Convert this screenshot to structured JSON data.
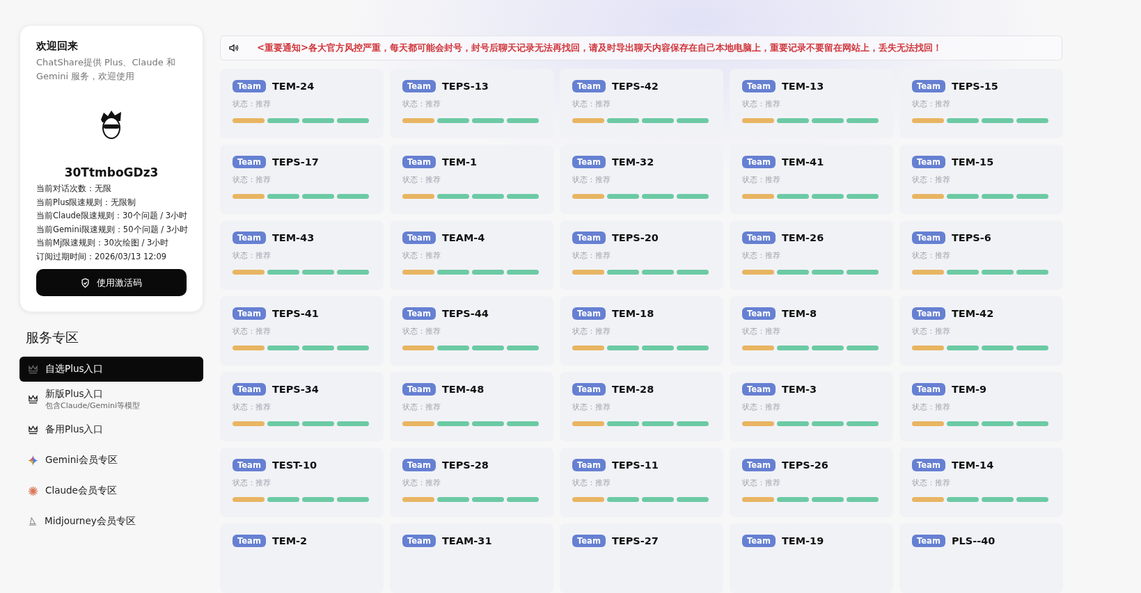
{
  "profile": {
    "title": "欢迎回来",
    "subtitle": "ChatShare提供 Plus、Claude 和 Gemini 服务，欢迎使用",
    "username": "30TtmboGDz3",
    "info": [
      "当前对话次数：无限",
      "当前Plus限速规则：无限制",
      "当前Claude限速规则：30个问题 / 3小时",
      "当前Gemini限速规则：50个问题 / 3小时",
      "当前Mj限速规则：30次绘图 / 3小时",
      "订阅过期时间：2026/03/13 12:09"
    ],
    "button": "使用激活码"
  },
  "sidebar": {
    "heading": "服务专区",
    "items": [
      {
        "kind": "crown",
        "label": "自选Plus入口",
        "selected": true
      },
      {
        "kind": "crown",
        "label": "新版Plus入口",
        "sub": "包含Claude/Gemini等模型",
        "selected": false
      },
      {
        "kind": "crown",
        "label": "备用Plus入口",
        "selected": false
      },
      {
        "kind": "gemini",
        "label": "Gemini会员专区",
        "selected": false
      },
      {
        "kind": "claude",
        "label": "Claude会员专区",
        "selected": false
      },
      {
        "kind": "midjourney",
        "label": "Midjourney会员专区",
        "selected": false
      }
    ]
  },
  "notice": "<重要通知>各大官方风控严重，每天都可能会封号，封号后聊天记录无法再找回，请及时导出聊天内容保存在自己本地电脑上，重要记录不要留在网站上，丢失无法找回！",
  "cards": [
    {
      "badge": "Team",
      "name": "TEM-24",
      "status": "状态：推荐",
      "bars": [
        {
          "color": "#e8b562"
        },
        {
          "color": "#6ccaa4"
        },
        {
          "color": "#6ccaa4"
        },
        {
          "color": "#6ccaa4"
        }
      ]
    },
    {
      "badge": "Team",
      "name": "TEPS-13",
      "status": "状态：推荐",
      "bars": [
        {
          "color": "#e8b562"
        },
        {
          "color": "#6ccaa4"
        },
        {
          "color": "#6ccaa4"
        },
        {
          "color": "#6ccaa4"
        }
      ]
    },
    {
      "badge": "Team",
      "name": "TEPS-42",
      "status": "状态：推荐",
      "bars": [
        {
          "color": "#e8b562"
        },
        {
          "color": "#6ccaa4"
        },
        {
          "color": "#6ccaa4"
        },
        {
          "color": "#6ccaa4"
        }
      ]
    },
    {
      "badge": "Team",
      "name": "TEM-13",
      "status": "状态：推荐",
      "bars": [
        {
          "color": "#e8b562"
        },
        {
          "color": "#6ccaa4"
        },
        {
          "color": "#6ccaa4"
        },
        {
          "color": "#6ccaa4"
        }
      ]
    },
    {
      "badge": "Team",
      "name": "TEPS-15",
      "status": "状态：推荐",
      "bars": [
        {
          "color": "#e8b562"
        },
        {
          "color": "#6ccaa4"
        },
        {
          "color": "#6ccaa4"
        },
        {
          "color": "#6ccaa4"
        }
      ]
    },
    {
      "badge": "Team",
      "name": "TEPS-17",
      "status": "状态：推荐",
      "bars": [
        {
          "color": "#e8b562"
        },
        {
          "color": "#6ccaa4"
        },
        {
          "color": "#6ccaa4"
        },
        {
          "color": "#6ccaa4"
        }
      ]
    },
    {
      "badge": "Team",
      "name": "TEM-1",
      "status": "状态：推荐",
      "bars": [
        {
          "color": "#e8b562"
        },
        {
          "color": "#6ccaa4"
        },
        {
          "color": "#6ccaa4"
        },
        {
          "color": "#6ccaa4"
        }
      ]
    },
    {
      "badge": "Team",
      "name": "TEM-32",
      "status": "状态：推荐",
      "bars": [
        {
          "color": "#e8b562"
        },
        {
          "color": "#6ccaa4"
        },
        {
          "color": "#6ccaa4"
        },
        {
          "color": "#6ccaa4"
        }
      ]
    },
    {
      "badge": "Team",
      "name": "TEM-41",
      "status": "状态：推荐",
      "bars": [
        {
          "color": "#e8b562"
        },
        {
          "color": "#6ccaa4"
        },
        {
          "color": "#6ccaa4"
        },
        {
          "color": "#6ccaa4"
        }
      ]
    },
    {
      "badge": "Team",
      "name": "TEM-15",
      "status": "状态：推荐",
      "bars": [
        {
          "color": "#e8b562"
        },
        {
          "color": "#6ccaa4"
        },
        {
          "color": "#6ccaa4"
        },
        {
          "color": "#6ccaa4"
        }
      ]
    },
    {
      "badge": "Team",
      "name": "TEM-43",
      "status": "状态：推荐",
      "bars": [
        {
          "color": "#e8b562"
        },
        {
          "color": "#6ccaa4"
        },
        {
          "color": "#6ccaa4"
        },
        {
          "color": "#6ccaa4"
        }
      ]
    },
    {
      "badge": "Team",
      "name": "TEAM-4",
      "status": "状态：推荐",
      "bars": [
        {
          "color": "#e8b562"
        },
        {
          "color": "#6ccaa4"
        },
        {
          "color": "#6ccaa4"
        },
        {
          "color": "#6ccaa4"
        }
      ]
    },
    {
      "badge": "Team",
      "name": "TEPS-20",
      "status": "状态：推荐",
      "bars": [
        {
          "color": "#e8b562"
        },
        {
          "color": "#6ccaa4"
        },
        {
          "color": "#6ccaa4"
        },
        {
          "color": "#6ccaa4"
        }
      ]
    },
    {
      "badge": "Team",
      "name": "TEM-26",
      "status": "状态：推荐",
      "bars": [
        {
          "color": "#e8b562"
        },
        {
          "color": "#6ccaa4"
        },
        {
          "color": "#6ccaa4"
        },
        {
          "color": "#6ccaa4"
        }
      ]
    },
    {
      "badge": "Team",
      "name": "TEPS-6",
      "status": "状态：推荐",
      "bars": [
        {
          "color": "#e8b562"
        },
        {
          "color": "#6ccaa4"
        },
        {
          "color": "#6ccaa4"
        },
        {
          "color": "#6ccaa4"
        }
      ]
    },
    {
      "badge": "Team",
      "name": "TEPS-41",
      "status": "状态：推荐",
      "bars": [
        {
          "color": "#e8b562"
        },
        {
          "color": "#6ccaa4"
        },
        {
          "color": "#6ccaa4"
        },
        {
          "color": "#6ccaa4"
        }
      ]
    },
    {
      "badge": "Team",
      "name": "TEPS-44",
      "status": "状态：推荐",
      "bars": [
        {
          "color": "#e8b562"
        },
        {
          "color": "#6ccaa4"
        },
        {
          "color": "#6ccaa4"
        },
        {
          "color": "#6ccaa4"
        }
      ]
    },
    {
      "badge": "Team",
      "name": "TEM-18",
      "status": "状态：推荐",
      "bars": [
        {
          "color": "#e8b562"
        },
        {
          "color": "#6ccaa4"
        },
        {
          "color": "#6ccaa4"
        },
        {
          "color": "#6ccaa4"
        }
      ]
    },
    {
      "badge": "Team",
      "name": "TEM-8",
      "status": "状态：推荐",
      "bars": [
        {
          "color": "#e8b562"
        },
        {
          "color": "#6ccaa4"
        },
        {
          "color": "#6ccaa4"
        },
        {
          "color": "#6ccaa4"
        }
      ]
    },
    {
      "badge": "Team",
      "name": "TEM-42",
      "status": "状态：推荐",
      "bars": [
        {
          "color": "#e8b562"
        },
        {
          "color": "#6ccaa4"
        },
        {
          "color": "#6ccaa4"
        },
        {
          "color": "#6ccaa4"
        }
      ]
    },
    {
      "badge": "Team",
      "name": "TEPS-34",
      "status": "状态：推荐",
      "bars": [
        {
          "color": "#e8b562"
        },
        {
          "color": "#6ccaa4"
        },
        {
          "color": "#6ccaa4"
        },
        {
          "color": "#6ccaa4"
        }
      ]
    },
    {
      "badge": "Team",
      "name": "TEM-48",
      "status": "状态：推荐",
      "bars": [
        {
          "color": "#e8b562"
        },
        {
          "color": "#6ccaa4"
        },
        {
          "color": "#6ccaa4"
        },
        {
          "color": "#6ccaa4"
        }
      ]
    },
    {
      "badge": "Team",
      "name": "TEM-28",
      "status": "状态：推荐",
      "bars": [
        {
          "color": "#e8b562"
        },
        {
          "color": "#6ccaa4"
        },
        {
          "color": "#6ccaa4"
        },
        {
          "color": "#6ccaa4"
        }
      ]
    },
    {
      "badge": "Team",
      "name": "TEM-3",
      "status": "状态：推荐",
      "bars": [
        {
          "color": "#e8b562"
        },
        {
          "color": "#6ccaa4"
        },
        {
          "color": "#6ccaa4"
        },
        {
          "color": "#6ccaa4"
        }
      ]
    },
    {
      "badge": "Team",
      "name": "TEM-9",
      "status": "状态：推荐",
      "bars": [
        {
          "color": "#e8b562"
        },
        {
          "color": "#6ccaa4"
        },
        {
          "color": "#6ccaa4"
        },
        {
          "color": "#6ccaa4"
        }
      ]
    },
    {
      "badge": "Team",
      "name": "TEST-10",
      "status": "状态：推荐",
      "bars": [
        {
          "color": "#e8b562"
        },
        {
          "color": "#6ccaa4"
        },
        {
          "color": "#6ccaa4"
        },
        {
          "color": "#6ccaa4"
        }
      ]
    },
    {
      "badge": "Team",
      "name": "TEPS-28",
      "status": "状态：推荐",
      "bars": [
        {
          "color": "#e8b562"
        },
        {
          "color": "#6ccaa4"
        },
        {
          "color": "#6ccaa4"
        },
        {
          "color": "#6ccaa4"
        }
      ]
    },
    {
      "badge": "Team",
      "name": "TEPS-11",
      "status": "状态：推荐",
      "bars": [
        {
          "color": "#e8b562"
        },
        {
          "color": "#6ccaa4"
        },
        {
          "color": "#6ccaa4"
        },
        {
          "color": "#6ccaa4"
        }
      ]
    },
    {
      "badge": "Team",
      "name": "TEPS-26",
      "status": "状态：推荐",
      "bars": [
        {
          "color": "#e8b562"
        },
        {
          "color": "#6ccaa4"
        },
        {
          "color": "#6ccaa4"
        },
        {
          "color": "#6ccaa4"
        }
      ]
    },
    {
      "badge": "Team",
      "name": "TEM-14",
      "status": "状态：推荐",
      "bars": [
        {
          "color": "#e8b562"
        },
        {
          "color": "#6ccaa4"
        },
        {
          "color": "#6ccaa4"
        },
        {
          "color": "#6ccaa4"
        }
      ]
    },
    {
      "badge": "Team",
      "name": "TEM-2"
    },
    {
      "badge": "Team",
      "name": "TEAM-31"
    },
    {
      "badge": "Team",
      "name": "TEPS-27"
    },
    {
      "badge": "Team",
      "name": "TEM-19"
    },
    {
      "badge": "Team",
      "name": "PLS--40"
    }
  ]
}
